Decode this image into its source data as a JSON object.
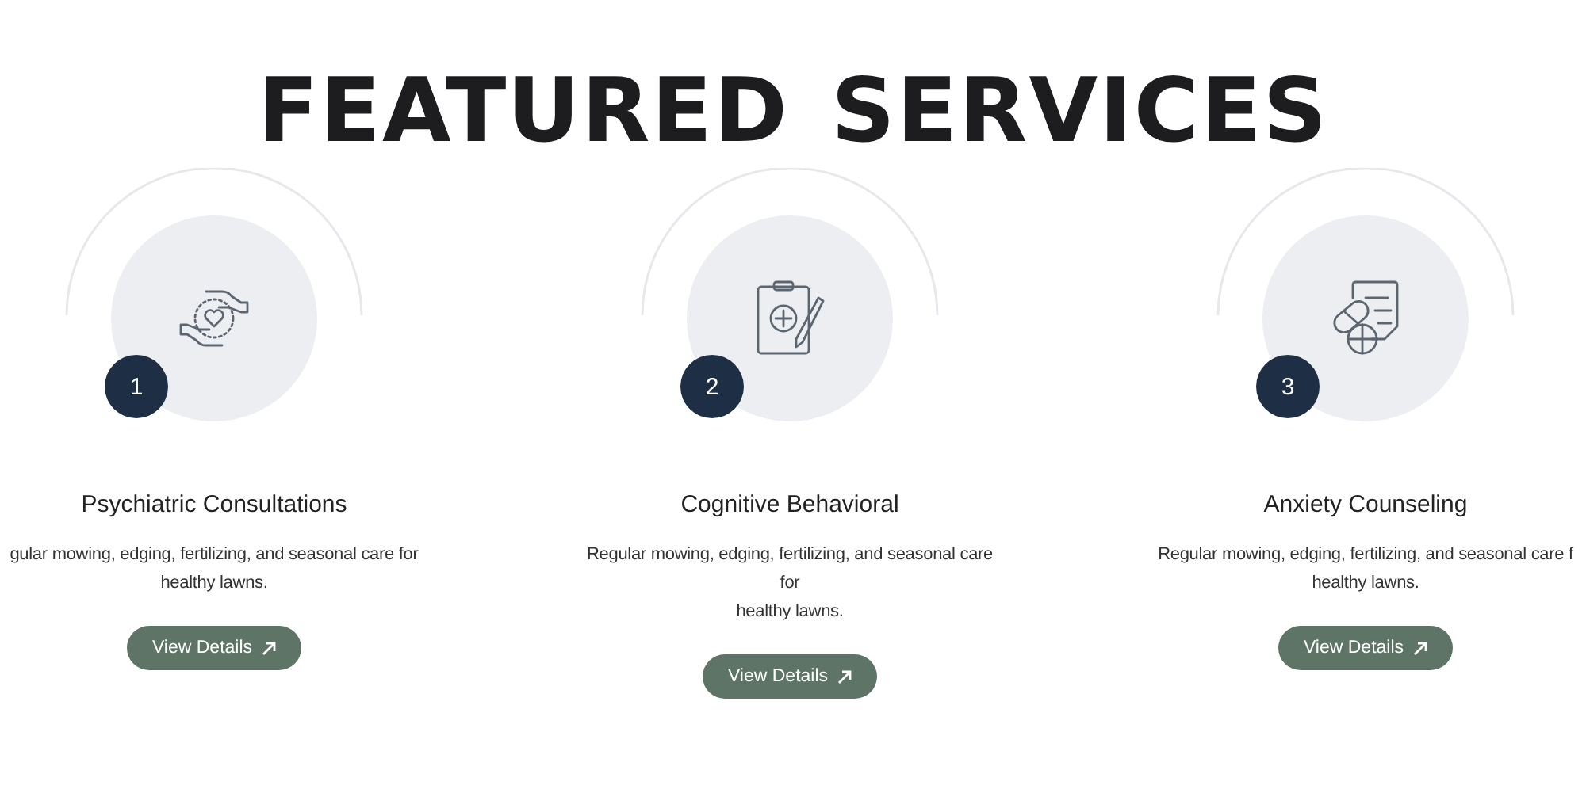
{
  "heading": "FEATURED SERVICES",
  "services": [
    {
      "number": "1",
      "kind": "hands",
      "title": "Psychiatric Consultations",
      "description": "gular mowing, edging, fertilizing, and seasonal care for\nhealthy lawns.",
      "button": "View Details"
    },
    {
      "number": "2",
      "kind": "clipboard",
      "title": "Cognitive Behavioral",
      "description": "Regular mowing, edging, fertilizing, and seasonal care for\nhealthy lawns.",
      "button": "View Details"
    },
    {
      "number": "3",
      "kind": "pills",
      "title": "Anxiety Counseling",
      "description": "Regular mowing, edging, fertilizing, and seasonal care f\nhealthy lawns.",
      "button": "View Details"
    }
  ]
}
